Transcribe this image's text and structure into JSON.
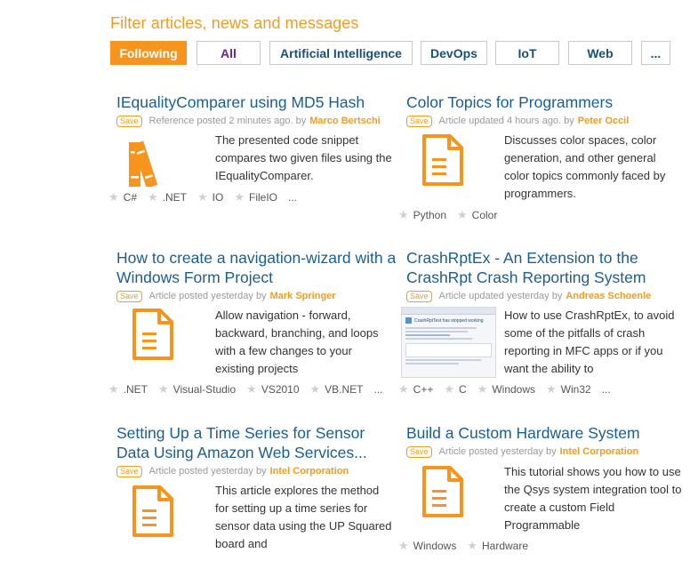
{
  "heading": "Filter articles, news and messages",
  "filters": [
    {
      "label": "Following"
    },
    {
      "label": "All"
    },
    {
      "label": "Artificial Intelligence"
    },
    {
      "label": "DevOps"
    },
    {
      "label": "IoT"
    },
    {
      "label": "Web"
    },
    {
      "label": "..."
    }
  ],
  "save_label": "Save",
  "articles": [
    {
      "title": "IEqualityComparer using MD5 Hash",
      "meta": "Reference posted 2 minutes ago. by",
      "author": "Marco Bertschi",
      "desc": "The presented code snippet compares two given files using the IEqualityComparer.",
      "thumb_icon": "books-icon",
      "tags": [
        "C#",
        ".NET",
        "IO",
        "FileIO"
      ],
      "more": "..."
    },
    {
      "title": "Color Topics for Programmers",
      "meta": "Article updated 4 hours ago. by",
      "author": "Peter Occil",
      "desc": "Discusses color spaces, color generation, and other general color topics commonly faced by programmers.",
      "thumb_icon": "document-icon",
      "tags": [
        "Python",
        "Color"
      ]
    },
    {
      "title": "How to create a navigation-wizard with a Windows Form Project",
      "meta": "Article posted yesterday by",
      "author": "Mark Springer",
      "desc": "Allow navigation - forward, backward, branching, and loops with a few changes to your existing projects",
      "thumb_icon": "document-icon",
      "tags": [
        ".NET",
        "Visual-Studio",
        "VS2010",
        "VB.NET"
      ],
      "more": "..."
    },
    {
      "title": "CrashRptEx - An Extension to the CrashRpt Crash Reporting System",
      "meta": "Article updated yesterday by",
      "author": "Andreas Schoenle",
      "desc": "How to use CrashRptEx, to avoid some of the pitfalls of crash reporting in MFC apps or if you want the ability to",
      "thumb_icon": "screenshot-thumbnail",
      "thumb_caption": "CrashRptTest has stopped working",
      "tags": [
        "C++",
        "C",
        "Windows",
        "Win32"
      ],
      "more": "..."
    },
    {
      "title": "Setting Up a Time Series for Sensor Data Using Amazon Web Services...",
      "meta": "Article posted yesterday by",
      "author": "Intel Corporation",
      "desc": "This article explores the method for setting up a time series for sensor data using the UP Squared board and",
      "thumb_icon": "document-icon",
      "tags": []
    },
    {
      "title": "Build a Custom Hardware System",
      "meta": "Article posted yesterday by",
      "author": "Intel Corporation",
      "desc": "This tutorial shows you how to use the Qsys system integration tool to create a custom Field Programmable",
      "thumb_icon": "document-icon",
      "tags": [
        "Windows",
        "Hardware"
      ]
    }
  ],
  "colors": {
    "accent": "#f7941d",
    "title": "#1a5e93",
    "all": "#6b1f9a"
  }
}
